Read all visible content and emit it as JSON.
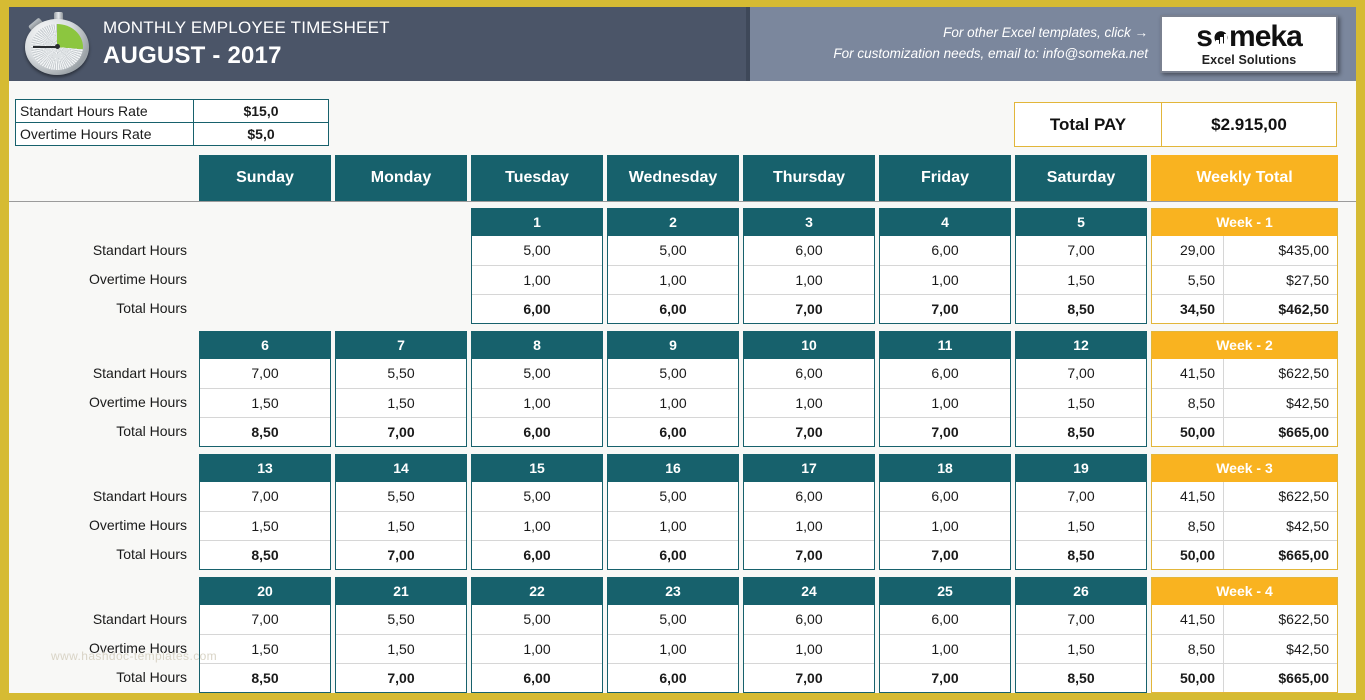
{
  "header": {
    "subtitle": "MONTHLY EMPLOYEE TIMESHEET",
    "title": "AUGUST - 2017",
    "promo_line1": "For other Excel templates, click →",
    "promo_line2": "For customization needs, email to: info@someka.net",
    "logo_word": "s●meka",
    "logo_tagline": "Excel Solutions",
    "band_color": "#4b5568",
    "band_right_color": "#7b879d"
  },
  "rates": {
    "standard_label": "Standart Hours Rate",
    "standard_value": "$15,0",
    "overtime_label": "Overtime Hours Rate",
    "overtime_value": "$5,0"
  },
  "total_pay": {
    "label": "Total PAY",
    "value": "$2.915,00"
  },
  "colors": {
    "teal": "#17616c",
    "yellow": "#f9b320",
    "gold_border": "#d6bb33",
    "navy": "#4b5568"
  },
  "columns": {
    "days": [
      "Sunday",
      "Monday",
      "Tuesday",
      "Wednesday",
      "Thursday",
      "Friday",
      "Saturday"
    ],
    "weekly_total": "Weekly Total"
  },
  "row_labels": [
    "Standart Hours",
    "Overtime Hours",
    "Total Hours"
  ],
  "watermark": "www.hashdoc-templates.com",
  "weeks": [
    {
      "label": "Week - 1",
      "days": [
        {
          "num": "",
          "standard": "",
          "overtime": "",
          "total": "",
          "empty": true
        },
        {
          "num": "",
          "standard": "",
          "overtime": "",
          "total": "",
          "empty": true
        },
        {
          "num": "1",
          "standard": "5,00",
          "overtime": "1,00",
          "total": "6,00"
        },
        {
          "num": "2",
          "standard": "5,00",
          "overtime": "1,00",
          "total": "6,00"
        },
        {
          "num": "3",
          "standard": "6,00",
          "overtime": "1,00",
          "total": "7,00"
        },
        {
          "num": "4",
          "standard": "6,00",
          "overtime": "1,00",
          "total": "7,00"
        },
        {
          "num": "5",
          "standard": "7,00",
          "overtime": "1,50",
          "total": "8,50"
        }
      ],
      "totals": {
        "standard_hours": "29,00",
        "standard_pay": "$435,00",
        "overtime_hours": "5,50",
        "overtime_pay": "$27,50",
        "total_hours": "34,50",
        "total_pay": "$462,50"
      }
    },
    {
      "label": "Week - 2",
      "days": [
        {
          "num": "6",
          "standard": "7,00",
          "overtime": "1,50",
          "total": "8,50"
        },
        {
          "num": "7",
          "standard": "5,50",
          "overtime": "1,50",
          "total": "7,00"
        },
        {
          "num": "8",
          "standard": "5,00",
          "overtime": "1,00",
          "total": "6,00"
        },
        {
          "num": "9",
          "standard": "5,00",
          "overtime": "1,00",
          "total": "6,00"
        },
        {
          "num": "10",
          "standard": "6,00",
          "overtime": "1,00",
          "total": "7,00"
        },
        {
          "num": "11",
          "standard": "6,00",
          "overtime": "1,00",
          "total": "7,00"
        },
        {
          "num": "12",
          "standard": "7,00",
          "overtime": "1,50",
          "total": "8,50"
        }
      ],
      "totals": {
        "standard_hours": "41,50",
        "standard_pay": "$622,50",
        "overtime_hours": "8,50",
        "overtime_pay": "$42,50",
        "total_hours": "50,00",
        "total_pay": "$665,00"
      }
    },
    {
      "label": "Week - 3",
      "days": [
        {
          "num": "13",
          "standard": "7,00",
          "overtime": "1,50",
          "total": "8,50"
        },
        {
          "num": "14",
          "standard": "5,50",
          "overtime": "1,50",
          "total": "7,00"
        },
        {
          "num": "15",
          "standard": "5,00",
          "overtime": "1,00",
          "total": "6,00"
        },
        {
          "num": "16",
          "standard": "5,00",
          "overtime": "1,00",
          "total": "6,00"
        },
        {
          "num": "17",
          "standard": "6,00",
          "overtime": "1,00",
          "total": "7,00"
        },
        {
          "num": "18",
          "standard": "6,00",
          "overtime": "1,00",
          "total": "7,00"
        },
        {
          "num": "19",
          "standard": "7,00",
          "overtime": "1,50",
          "total": "8,50"
        }
      ],
      "totals": {
        "standard_hours": "41,50",
        "standard_pay": "$622,50",
        "overtime_hours": "8,50",
        "overtime_pay": "$42,50",
        "total_hours": "50,00",
        "total_pay": "$665,00"
      }
    },
    {
      "label": "Week - 4",
      "days": [
        {
          "num": "20",
          "standard": "7,00",
          "overtime": "1,50",
          "total": "8,50"
        },
        {
          "num": "21",
          "standard": "5,50",
          "overtime": "1,50",
          "total": "7,00"
        },
        {
          "num": "22",
          "standard": "5,00",
          "overtime": "1,00",
          "total": "6,00"
        },
        {
          "num": "23",
          "standard": "5,00",
          "overtime": "1,00",
          "total": "6,00"
        },
        {
          "num": "24",
          "standard": "6,00",
          "overtime": "1,00",
          "total": "7,00"
        },
        {
          "num": "25",
          "standard": "6,00",
          "overtime": "1,00",
          "total": "7,00"
        },
        {
          "num": "26",
          "standard": "7,00",
          "overtime": "1,50",
          "total": "8,50"
        }
      ],
      "totals": {
        "standard_hours": "41,50",
        "standard_pay": "$622,50",
        "overtime_hours": "8,50",
        "overtime_pay": "$42,50",
        "total_hours": "50,00",
        "total_pay": "$665,00"
      }
    }
  ]
}
